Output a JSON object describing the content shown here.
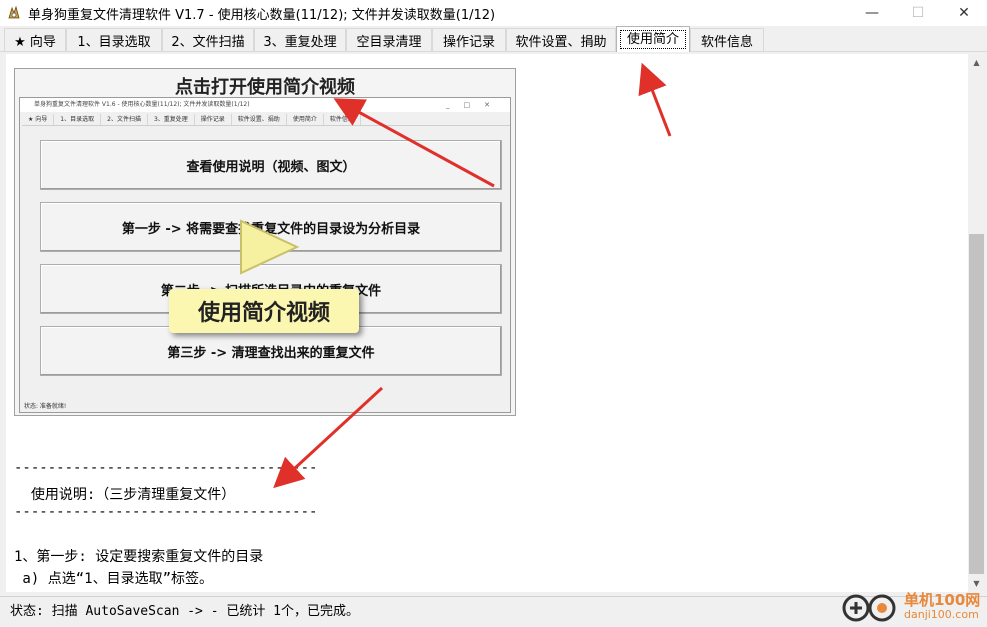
{
  "window": {
    "title": "单身狗重复文件清理软件 V1.7  - 使用核心数量(11/12); 文件并发读取数量(1/12)",
    "controls": {
      "minimize": "—",
      "maximize": "☐",
      "close": "✕"
    }
  },
  "tabs": [
    {
      "label": "★ 向导"
    },
    {
      "label": "1、目录选取"
    },
    {
      "label": "2、文件扫描"
    },
    {
      "label": "3、重复处理"
    },
    {
      "label": "空目录清理"
    },
    {
      "label": "操作记录"
    },
    {
      "label": "软件设置、捐助"
    },
    {
      "label": "使用简介"
    },
    {
      "label": "软件信息"
    }
  ],
  "active_tab": "使用简介",
  "preview": {
    "heading": "点击打开使用简介视频",
    "mini_title": "单身狗重复文件清理软件 V1.6  - 使用核心数量(11/12); 文件并发读取数量(1/12)",
    "mini_tabs": [
      "★ 向导",
      "1、目录选取",
      "2、文件扫描",
      "3、重复处理",
      "操作记录",
      "软件设置、捐助",
      "使用简介",
      "软件信息"
    ],
    "buttons": [
      "查看使用说明（视频、图文）",
      "第一步 -> 将需要查找重复文件的目录设为分析目录",
      "第二步 -> 扫描所选目录中的重复文件",
      "第三步 -> 清理查找出来的重复文件"
    ],
    "mini_status": "状态: 准备就绪!",
    "overlay_label": "使用简介视频"
  },
  "doc": {
    "rule_top": "------------------------------------",
    "heading": "  使用说明:（三步清理重复文件）",
    "rule_bottom": "------------------------------------",
    "step1": "1、第一步: 设定要搜索重复文件的目录",
    "step1a": " a) 点选“1、目录选取”标签。"
  },
  "status": {
    "text": "状态: 扫描 AutoSaveScan -> - 已统计 1个，已完成。"
  },
  "watermark": {
    "cn": "单机100网",
    "url": "danji100.com"
  },
  "colors": {
    "arrow": "#e0302a",
    "overlay_bg": "#fbf7b0",
    "watermark": "#e8883a"
  }
}
